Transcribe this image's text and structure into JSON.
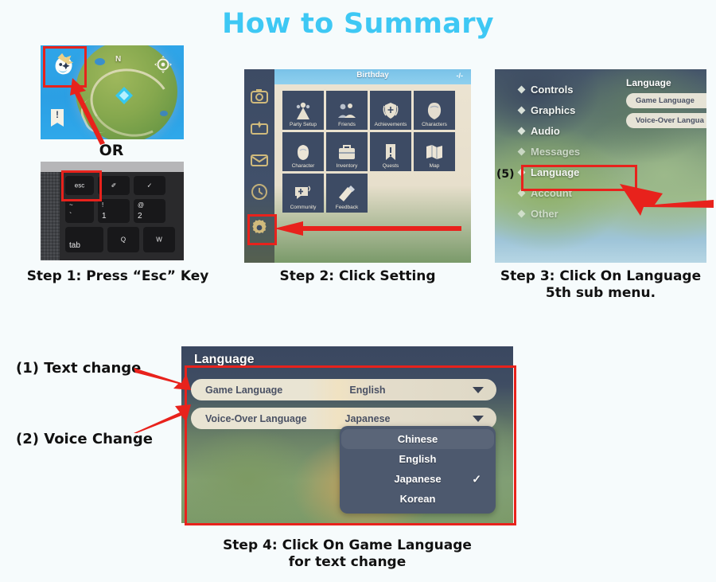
{
  "title": "How to Summary",
  "accent_color": "#3ec8f4",
  "highlight_color": "#e8221c",
  "background_color": "#f6fbfc",
  "step1": {
    "caption": "Step 1: Press “Esc” Key",
    "or_label": "OR",
    "minimap": {
      "compass_label": "N",
      "paimon_icon": "paimon-menu-icon",
      "eye_icon": "eye-marker-icon",
      "quest_icon": "quest-banner-icon",
      "waypoint_icon": "waypoint-diamond-icon"
    },
    "keyboard": {
      "keys": [
        {
          "id": "esc",
          "center": "esc",
          "highlighted": true
        },
        {
          "id": "f1",
          "center": "✐",
          "highlighted": false
        },
        {
          "id": "f2",
          "center": "✓",
          "highlighted": false
        },
        {
          "id": "tilde",
          "top": "~",
          "bottom": "`",
          "highlighted": false
        },
        {
          "id": "one",
          "top": "!",
          "bottom": "1",
          "highlighted": false
        },
        {
          "id": "two",
          "top": "@",
          "bottom": "2",
          "highlighted": false
        },
        {
          "id": "tab",
          "center": "tab",
          "highlighted": false
        },
        {
          "id": "q",
          "center": "Q",
          "highlighted": false
        },
        {
          "id": "w",
          "center": "W",
          "highlighted": false
        }
      ]
    }
  },
  "step2": {
    "caption": "Step 2: Click Setting",
    "header_title": "Birthday",
    "header_right": "-/-",
    "sidebar_icons": [
      "camera-icon",
      "battle-pass-icon",
      "mail-icon",
      "events-clock-icon",
      "settings-gear-icon"
    ],
    "tiles": [
      {
        "label": "Party Setup",
        "icon": "party-setup-icon"
      },
      {
        "label": "Friends",
        "icon": "friends-icon"
      },
      {
        "label": "Achievements",
        "icon": "achievements-icon"
      },
      {
        "label": "Characters",
        "icon": "characters-icon"
      },
      {
        "label": "Character",
        "icon": "character-icon"
      },
      {
        "label": "Inventory",
        "icon": "inventory-icon"
      },
      {
        "label": "Quests",
        "icon": "quests-icon"
      },
      {
        "label": "Map",
        "icon": "map-icon"
      },
      {
        "label": "Community",
        "icon": "community-icon"
      },
      {
        "label": "Feedback",
        "icon": "feedback-icon"
      }
    ]
  },
  "step3": {
    "caption": "Step 3: Click On Language\n5th sub menu.",
    "caption_line1": "Step 3: Click On Language",
    "caption_line2": "5th sub menu.",
    "order_marker": "(5)",
    "menu_items": [
      {
        "label": "Controls",
        "selected": false
      },
      {
        "label": "Graphics",
        "selected": false
      },
      {
        "label": "Audio",
        "selected": false
      },
      {
        "label": "Messages",
        "selected": false
      },
      {
        "label": "Language",
        "selected": true
      },
      {
        "label": "Account",
        "selected": false
      },
      {
        "label": "Other",
        "selected": false
      }
    ],
    "panel_title": "Language",
    "panel_rows": [
      "Game Language",
      "Voice-Over Langua"
    ]
  },
  "step4": {
    "caption_line1": "Step 4: Click On Game Language",
    "caption_line2": "for text change",
    "dialog_title": "Language",
    "rows": [
      {
        "label": "Game Language",
        "value": "English"
      },
      {
        "label": "Voice-Over Language",
        "value": "Japanese"
      }
    ],
    "dropdown_options": [
      {
        "label": "Chinese",
        "checked": false,
        "hover": true
      },
      {
        "label": "English",
        "checked": false,
        "hover": false
      },
      {
        "label": "Japanese",
        "checked": true,
        "hover": false
      },
      {
        "label": "Korean",
        "checked": false,
        "hover": false
      }
    ],
    "check_glyph": "✓",
    "annotations": [
      {
        "label": "(1) Text change"
      },
      {
        "label": "(2) Voice Change"
      }
    ]
  }
}
